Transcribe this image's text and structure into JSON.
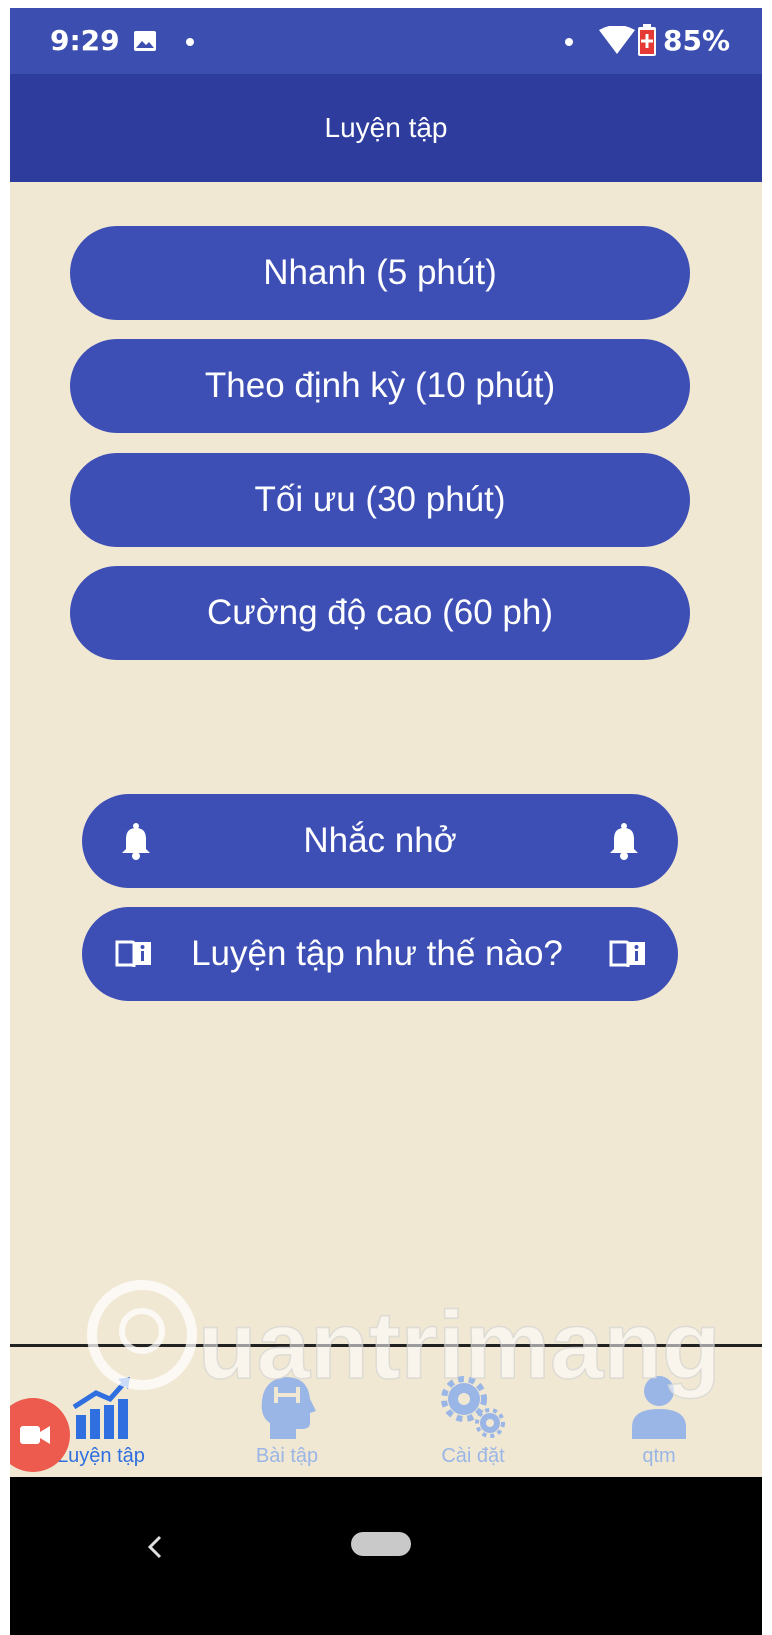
{
  "status_bar": {
    "time": "9:29",
    "battery_percent": "85%",
    "icons": [
      "image-icon",
      "dot-icon",
      "dot-icon",
      "wifi-icon",
      "battery-icon"
    ]
  },
  "app_bar": {
    "title": "Luyện tập"
  },
  "practice_options": [
    {
      "label": "Nhanh (5 phút)"
    },
    {
      "label": "Theo định kỳ (10 phút)"
    },
    {
      "label": "Tối ưu (30 phút)"
    },
    {
      "label": "Cường độ cao (60 ph)"
    }
  ],
  "secondary_actions": {
    "reminder": {
      "label": "Nhắc nhở",
      "icon": "bell-icon"
    },
    "how_to": {
      "label": "Luyện tập như thế nào?",
      "icon": "book-info-icon"
    }
  },
  "bottom_nav": {
    "items": [
      {
        "label": "Luyện tập",
        "icon": "chart-icon",
        "active": true
      },
      {
        "label": "Bài tập",
        "icon": "head-dumbbell-icon",
        "active": false
      },
      {
        "label": "Cài đặt",
        "icon": "gears-icon",
        "active": false
      },
      {
        "label": "qtm",
        "icon": "user-icon",
        "active": false
      }
    ]
  },
  "watermark": {
    "text": "Quantrimang"
  },
  "colors": {
    "primary": "#3d4fb5",
    "app_bar": "#2e3c9d",
    "background": "#f1e8d4",
    "nav_active": "#2f6fdf",
    "nav_inactive": "#9ab6e6"
  }
}
